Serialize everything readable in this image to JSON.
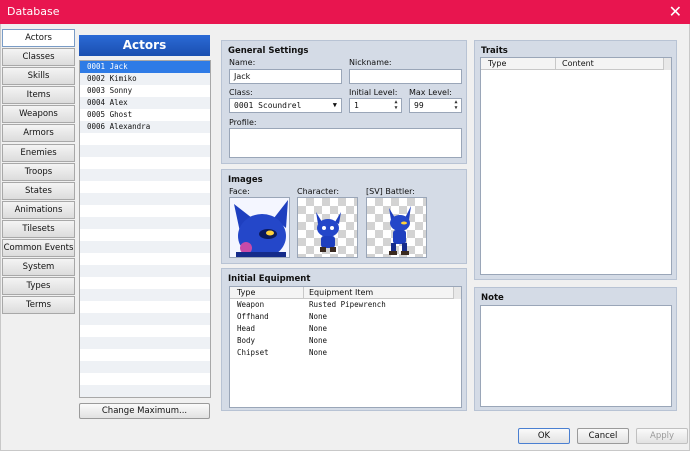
{
  "window": {
    "title": "Database",
    "close_glyph": "✕"
  },
  "tabs": [
    "Actors",
    "Classes",
    "Skills",
    "Items",
    "Weapons",
    "Armors",
    "Enemies",
    "Troops",
    "States",
    "Animations",
    "Tilesets",
    "Common Events",
    "System",
    "Types",
    "Terms"
  ],
  "active_tab": "Actors",
  "actors_panel": {
    "header": "Actors",
    "items": [
      "0001 Jack",
      "0002 Kimiko",
      "0003 Sonny",
      "0004 Alex",
      "0005 Ghost",
      "0006 Alexandra"
    ],
    "selected_index": 0,
    "change_max_label": "Change Maximum..."
  },
  "general": {
    "title": "General Settings",
    "name_label": "Name:",
    "name_value": "Jack",
    "nickname_label": "Nickname:",
    "nickname_value": "",
    "class_label": "Class:",
    "class_value": "0001 Scoundrel",
    "initial_level_label": "Initial Level:",
    "initial_level_value": "1",
    "max_level_label": "Max Level:",
    "max_level_value": "99",
    "profile_label": "Profile:",
    "profile_value": ""
  },
  "images": {
    "title": "Images",
    "face_label": "Face:",
    "character_label": "Character:",
    "battler_label": "[SV] Battler:"
  },
  "equipment": {
    "title": "Initial Equipment",
    "col_type": "Type",
    "col_item": "Equipment Item",
    "rows": [
      {
        "type": "Weapon",
        "item": "Rusted Pipewrench"
      },
      {
        "type": "Offhand",
        "item": "None"
      },
      {
        "type": "Head",
        "item": "None"
      },
      {
        "type": "Body",
        "item": "None"
      },
      {
        "type": "Chipset",
        "item": "None"
      }
    ]
  },
  "traits": {
    "title": "Traits",
    "col_type": "Type",
    "col_content": "Content"
  },
  "note": {
    "title": "Note",
    "value": ""
  },
  "footer": {
    "ok": "OK",
    "cancel": "Cancel",
    "apply": "Apply"
  },
  "colors": {
    "titlebar": "#e8154f",
    "accent": "#2e7be6",
    "panel": "#d4dbe6"
  }
}
